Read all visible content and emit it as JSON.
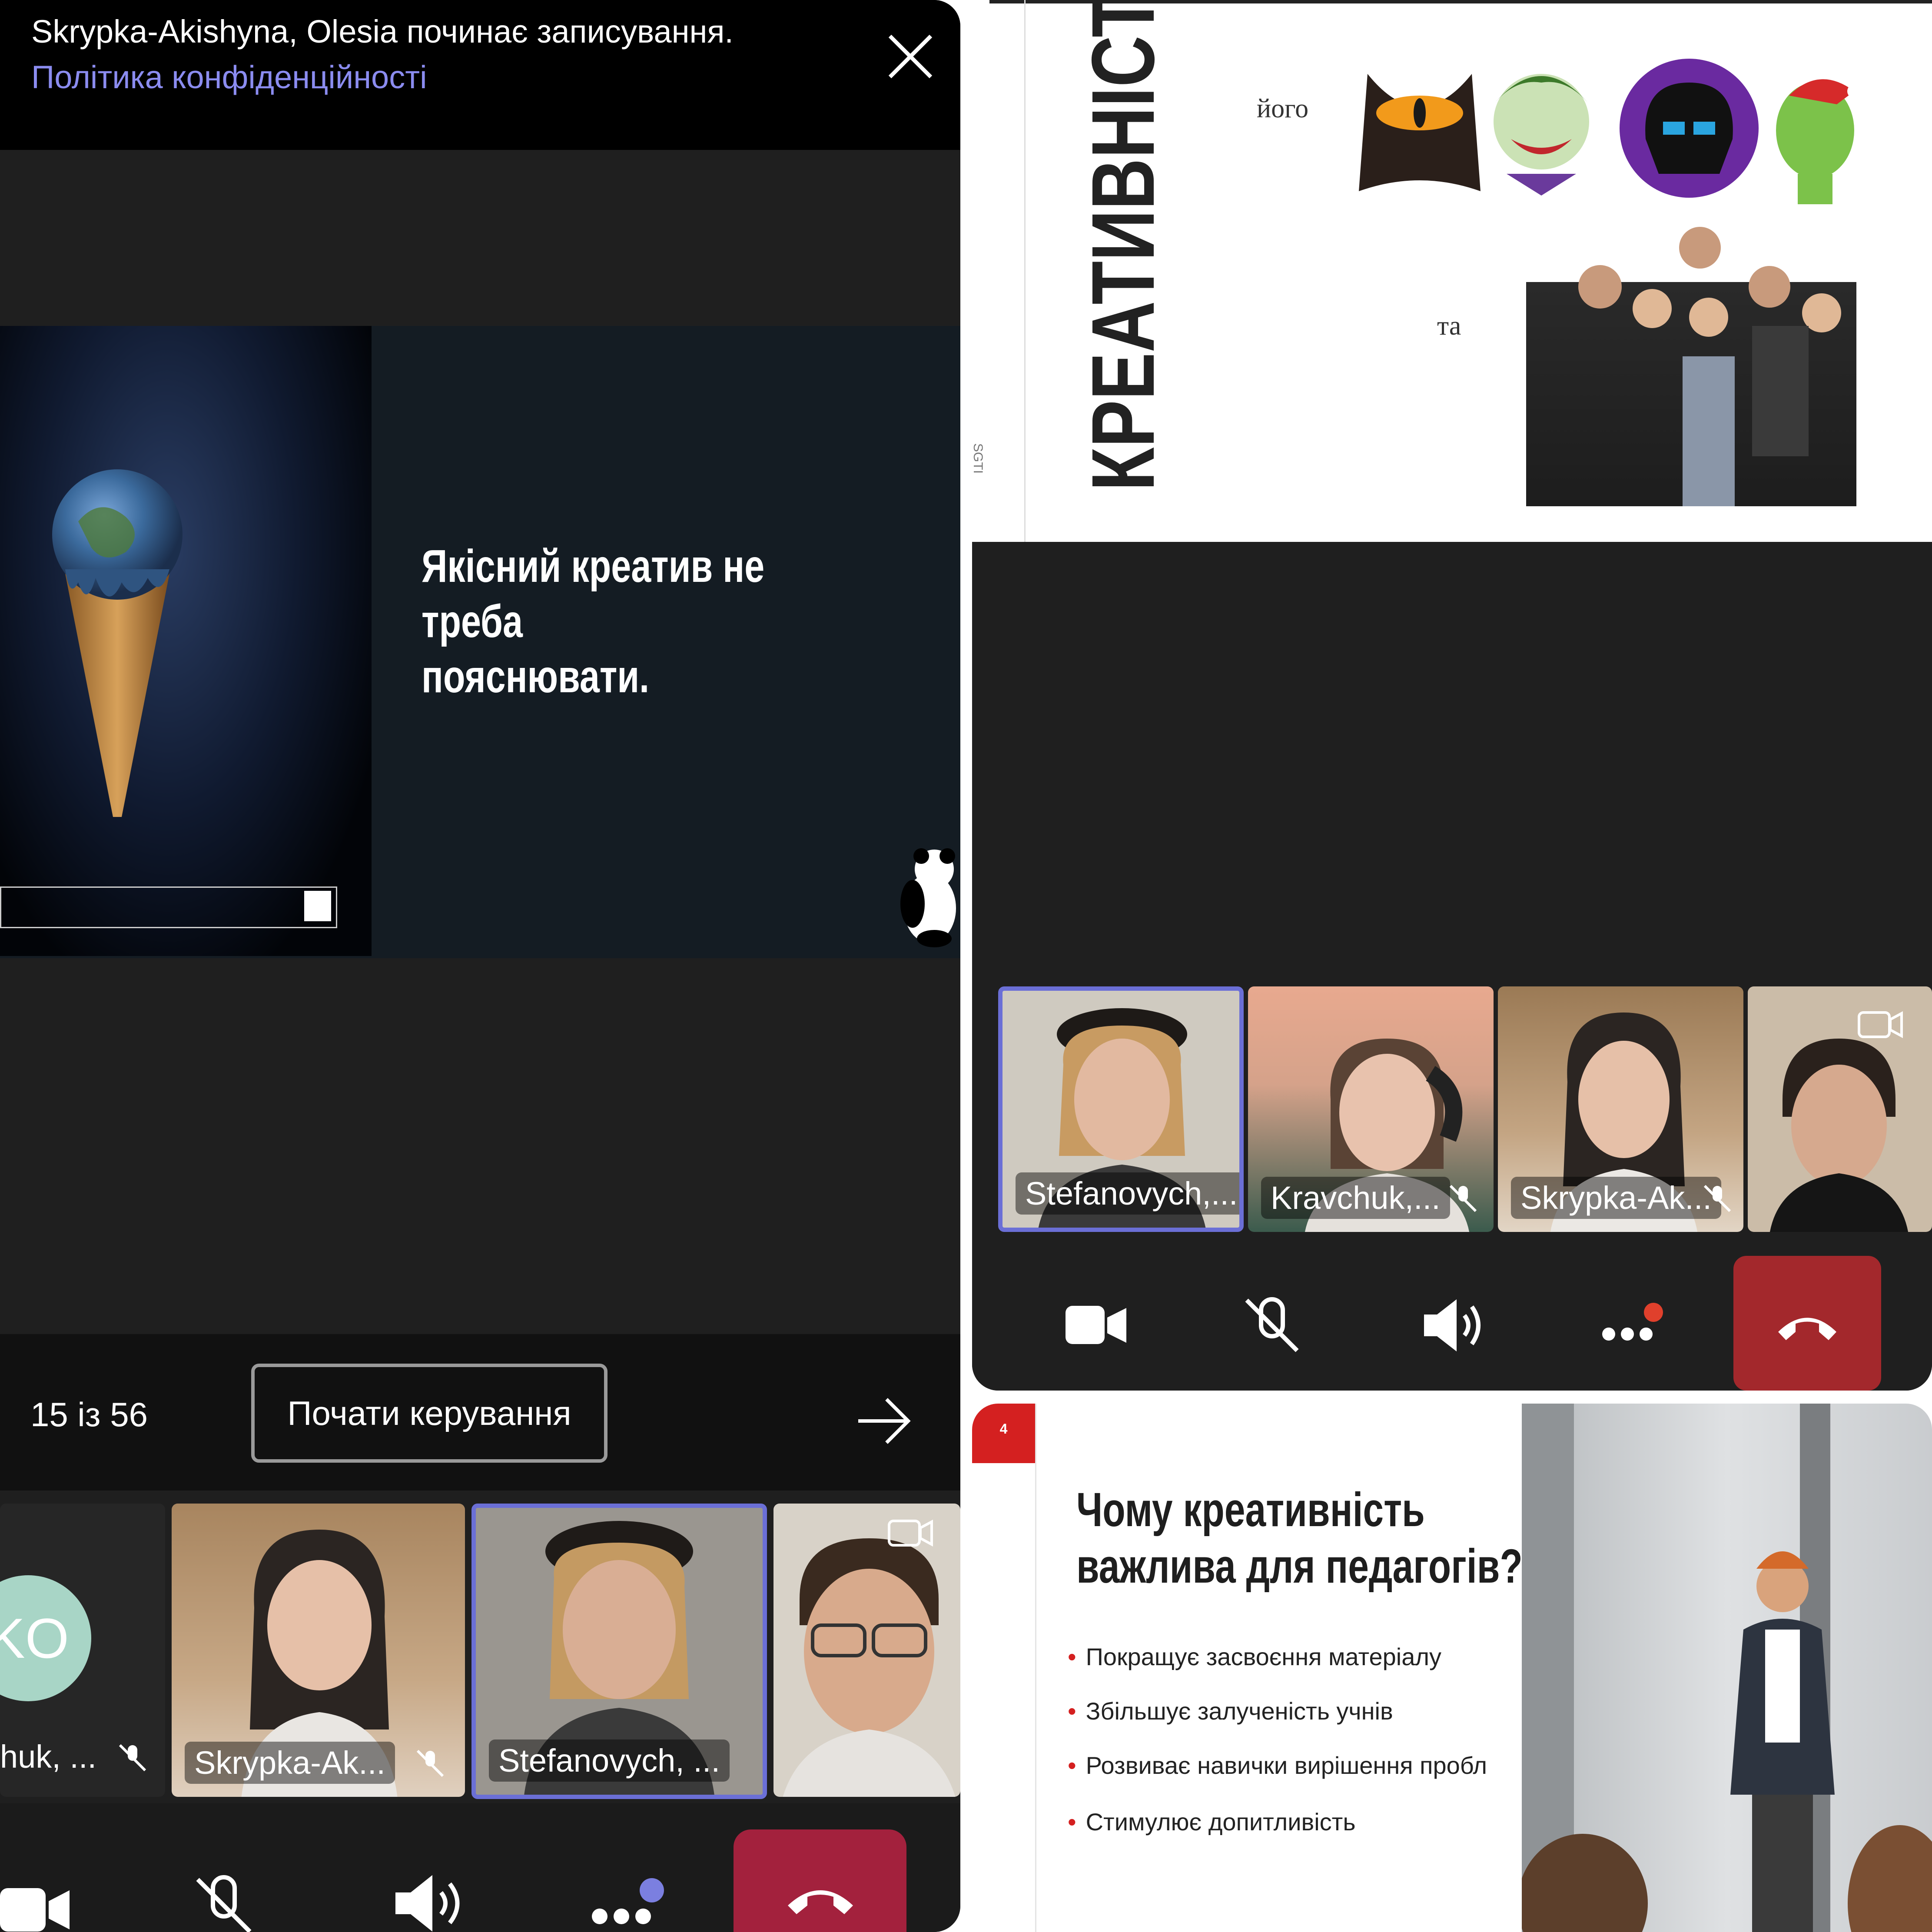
{
  "left_call": {
    "banner": {
      "recording_text": "Skrypka-Akishyna, Olesia починає записування.",
      "privacy_link": "Політика конфіденційності"
    },
    "slide": {
      "quote_line1": "Якісний креатив не треба",
      "quote_line2": "пояснювати."
    },
    "presenter_controls": {
      "page_counter": "15 із 56",
      "take_control_label": "Почати керування"
    },
    "participants": [
      {
        "name": "huk, ...",
        "initials": "KO",
        "muted": true
      },
      {
        "name": "Skrypka-Ak...",
        "muted": true
      },
      {
        "name": "Stefanovych, ...",
        "active_speaker": true
      },
      {
        "name": ""
      }
    ]
  },
  "right_call": {
    "slide": {
      "title": "КРЕАТИВНІСТЬ",
      "word_1": "його",
      "word_2": "та",
      "side_logo": "SGTI"
    },
    "participants": [
      {
        "name": "Stefanovych,...",
        "active_speaker": true
      },
      {
        "name": "Kravchuk,...",
        "muted": true
      },
      {
        "name": "Skrypka-Ak...",
        "muted": true
      },
      {
        "name": ""
      }
    ]
  },
  "bottom_slide": {
    "page_number": "4",
    "title_line1": "Чому креативність",
    "title_line2": "важлива для педагогів?",
    "bullets": [
      "Покращує засвоєння матеріалу",
      "Збільшує залученість учнів",
      "Розвиває навички вирішення пробл",
      "Стимулює допитливість"
    ]
  },
  "icons": [
    "close-icon",
    "arrow-right-icon",
    "camera-icon",
    "mic-off-icon",
    "speaker-icon",
    "more-icon",
    "hang-up-icon",
    "switch-camera-icon"
  ],
  "colors": {
    "hangup": "#a3213d",
    "active_border": "#6b6fd6",
    "link": "#8b8cf0",
    "slide_accent": "#d42020"
  }
}
